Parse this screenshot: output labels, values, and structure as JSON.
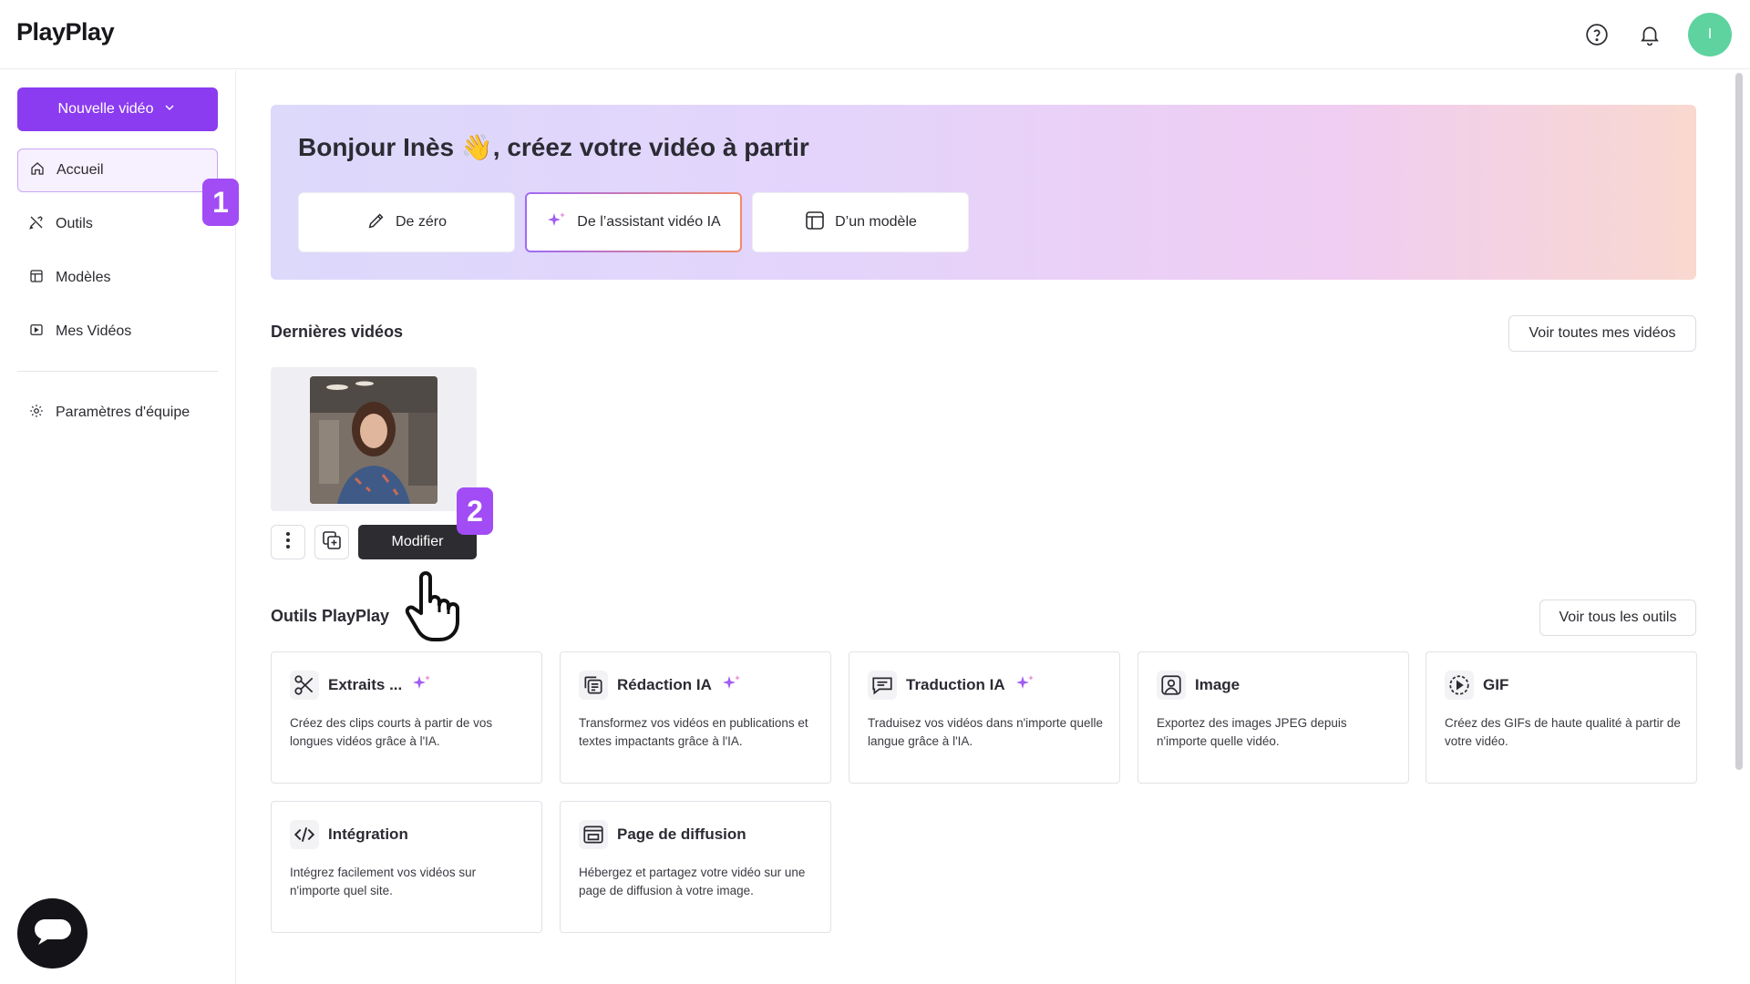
{
  "app": {
    "logo": "PlayPlay"
  },
  "header": {
    "help_icon": "question-circle-icon",
    "bell_icon": "bell-icon",
    "avatar_initial": "I",
    "avatar_color": "#5ed3a0"
  },
  "sidebar": {
    "new_video_label": "Nouvelle vidéo",
    "items": [
      {
        "label": "Accueil",
        "icon": "home-icon",
        "active": true
      },
      {
        "label": "Outils",
        "icon": "tools-icon",
        "active": false
      },
      {
        "label": "Modèles",
        "icon": "template-icon",
        "active": false
      },
      {
        "label": "Mes Vidéos",
        "icon": "video-icon",
        "active": false
      },
      {
        "label": "Paramètres d'équipe",
        "icon": "gear-icon",
        "active": false
      }
    ],
    "accent_color": "#8b3cf0"
  },
  "badges": {
    "step1": "1",
    "step2": "2"
  },
  "hero": {
    "title": "Bonjour Inès 👋, créez votre vidéo à partir",
    "buttons": [
      {
        "label": "De zéro",
        "icon": "pencil-icon"
      },
      {
        "label": "De l’assistant vidéo IA",
        "icon": "sparkle-icon"
      },
      {
        "label": "D’un modèle",
        "icon": "template-icon"
      }
    ]
  },
  "latest_videos": {
    "title": "Dernières vidéos",
    "see_all": "Voir toutes mes vidéos",
    "modify_label": "Modifier"
  },
  "tools": {
    "title": "Outils PlayPlay",
    "see_all": "Voir tous les outils",
    "items": [
      {
        "name": "Extraits ...",
        "icon": "scissors-icon",
        "ai": true,
        "desc": "Créez des clips courts à partir de vos longues vidéos grâce à l'IA."
      },
      {
        "name": "Rédaction IA",
        "icon": "copy-text-icon",
        "ai": true,
        "desc": "Transformez vos vidéos en publications et textes impactants grâce à l'IA."
      },
      {
        "name": "Traduction IA",
        "icon": "message-icon",
        "ai": true,
        "desc": "Traduisez vos vidéos dans n'importe quelle langue grâce à l'IA."
      },
      {
        "name": "Image",
        "icon": "image-icon",
        "ai": false,
        "desc": "Exportez des images JPEG depuis n'importe quelle vidéo."
      },
      {
        "name": "GIF",
        "icon": "gif-play-icon",
        "ai": false,
        "desc": "Créez des GIFs de haute qualité à partir de votre vidéo."
      },
      {
        "name": "Intégration",
        "icon": "code-icon",
        "ai": false,
        "desc": "Intégrez facilement vos vidéos sur n'importe quel site."
      },
      {
        "name": "Page de diffusion",
        "icon": "browser-page-icon",
        "ai": false,
        "desc": "Hébergez et partagez votre vidéo sur une page de diffusion à votre image."
      }
    ]
  }
}
